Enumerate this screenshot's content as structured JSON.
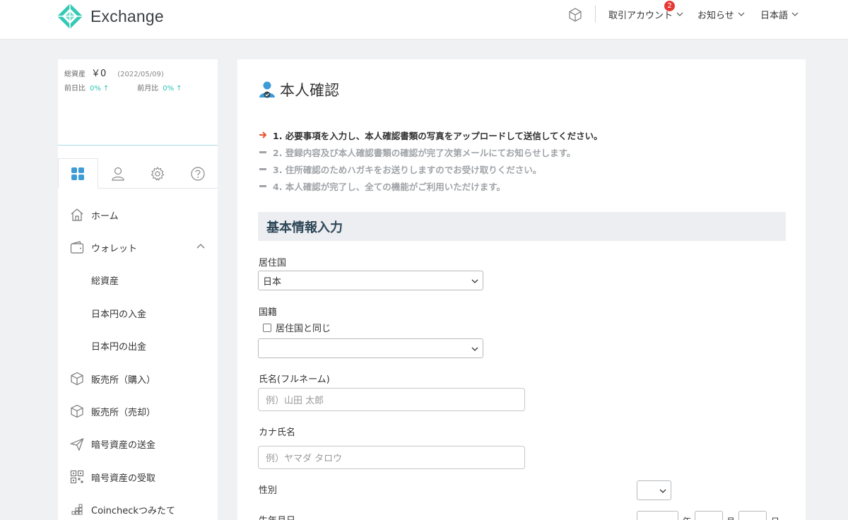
{
  "header": {
    "logo_text": "Exchange",
    "account_menu": "取引アカウント",
    "account_badge": "2",
    "notice_menu": "お知らせ",
    "lang_menu": "日本語"
  },
  "sidebar": {
    "assets": {
      "total_label": "総資産",
      "total_value": "￥0",
      "date": "(2022/05/09)",
      "day_label": "前日比",
      "day_value": "0%",
      "month_label": "前月比",
      "month_value": "0%",
      "arrow": "↑"
    },
    "tabs": [
      "grid-icon",
      "user-icon",
      "gear-icon",
      "help-icon"
    ],
    "nav": [
      {
        "label": "ホーム",
        "icon": "home-icon"
      },
      {
        "label": "ウォレット",
        "icon": "wallet-icon"
      },
      {
        "label": "総資産",
        "icon": ""
      },
      {
        "label": "日本円の入金",
        "icon": ""
      },
      {
        "label": "日本円の出金",
        "icon": ""
      },
      {
        "label": "販売所（購入）",
        "icon": "box-icon"
      },
      {
        "label": "販売所（売却）",
        "icon": "box-icon"
      },
      {
        "label": "暗号資産の送金",
        "icon": "paper-plane-icon"
      },
      {
        "label": "暗号資産の受取",
        "icon": "qr-code-icon"
      },
      {
        "label": "Coincheckつみたて",
        "icon": "blocks-icon"
      }
    ]
  },
  "main": {
    "title": "本人確認",
    "steps": [
      "1. 必要事項を入力し、本人確認書類の写真をアップロードして送信してください。",
      "2. 登録内容及び本人確認書類の確認が完了次第メールにてお知らせします。",
      "3. 住所確認のためハガキをお送りしますのでお受け取りください。",
      "4. 本人確認が完了し、全ての機能がご利用いただけます。"
    ],
    "section_title": "基本情報入力",
    "residence": {
      "label": "居住国",
      "value": "日本"
    },
    "nationality": {
      "label": "国籍",
      "same_label": "居住国と同じ",
      "value": ""
    },
    "fullname": {
      "label": "氏名(フルネーム)",
      "placeholder": "例）山田 太郎"
    },
    "kana": {
      "label": "カナ氏名",
      "placeholder": "例）ヤマダ タロウ"
    },
    "gender": {
      "label": "性別"
    },
    "birthdate": {
      "label": "生年月日",
      "year_sep": "年",
      "month_sep": "月",
      "day_sep": "日"
    }
  },
  "colors": {
    "brand": "#2ec4b6",
    "accent_arrow": "#e8552f",
    "badge": "#e53935",
    "section_bg": "#eceef1",
    "page_bg": "#eff1f3"
  }
}
